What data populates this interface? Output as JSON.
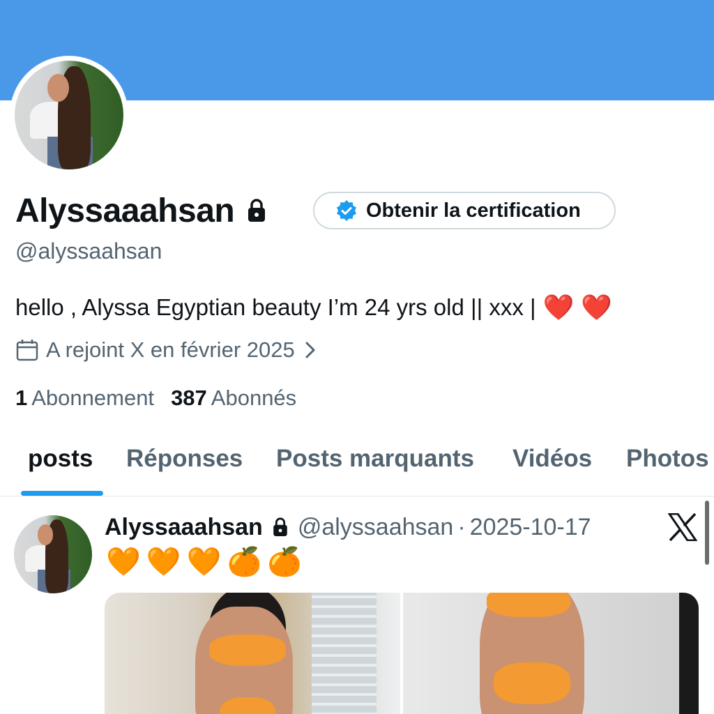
{
  "profile": {
    "display_name": "Alyssaaahsan",
    "handle": "@alyssaahsan",
    "bio_text": "hello , Alyssa Egyptian beauty I’m 24 yrs old || xxx |",
    "bio_hearts": [
      "❤️",
      "❤️"
    ],
    "joined": "A rejoint X en février 2025",
    "following_count": "1",
    "following_label": "Abonnement",
    "followers_count": "387",
    "followers_label": "Abonnés"
  },
  "certification_button": {
    "label": "Obtenir la certification"
  },
  "tabs": [
    {
      "label": "posts",
      "active": true
    },
    {
      "label": "Réponses",
      "active": false
    },
    {
      "label": "Posts marquants",
      "active": false
    },
    {
      "label": "Vidéos",
      "active": false
    },
    {
      "label": "Photos",
      "active": false
    }
  ],
  "post": {
    "author": "Alyssaaahsan",
    "handle": "@alyssaahsan",
    "separator": "·",
    "date": "2025-10-17",
    "emojis": [
      "🧡",
      "🧡",
      "🧡",
      "🍊",
      "🍊"
    ]
  },
  "colors": {
    "banner": "#4a99e9",
    "accent": "#1d9bf0",
    "text_primary": "#0f1419",
    "text_secondary": "#536471"
  },
  "icons": [
    "lock-icon",
    "verified-badge-icon",
    "calendar-icon",
    "chevron-right-icon",
    "x-logo-icon"
  ]
}
